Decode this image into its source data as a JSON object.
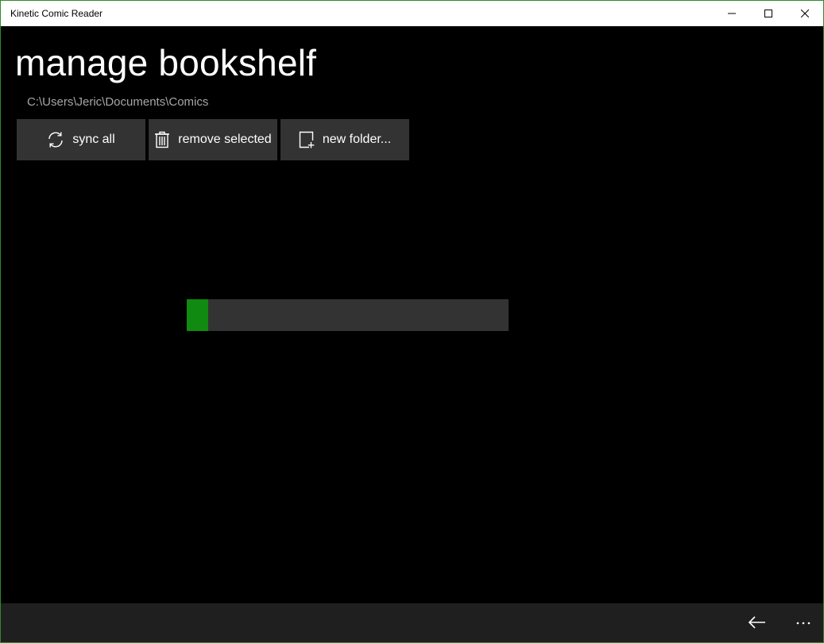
{
  "window": {
    "title": "Kinetic Comic Reader"
  },
  "page": {
    "title": "manage bookshelf",
    "path": "C:\\Users\\Jeric\\Documents\\Comics"
  },
  "toolbar": {
    "sync_label": "sync all",
    "remove_label": "remove selected",
    "new_folder_label": "new folder..."
  },
  "progress": {
    "value_fraction": 0.067
  },
  "icons": {
    "sync": "sync-icon",
    "trash": "trash-icon",
    "new_folder": "new-folder-icon",
    "back": "back-arrow-icon",
    "more": "more-icon"
  },
  "colors": {
    "accent": "#108a10",
    "window_border": "#2e8b2e",
    "button_bg": "#333333",
    "appbar_bg": "#1f1f1f",
    "path_text": "#a6a6a6"
  }
}
